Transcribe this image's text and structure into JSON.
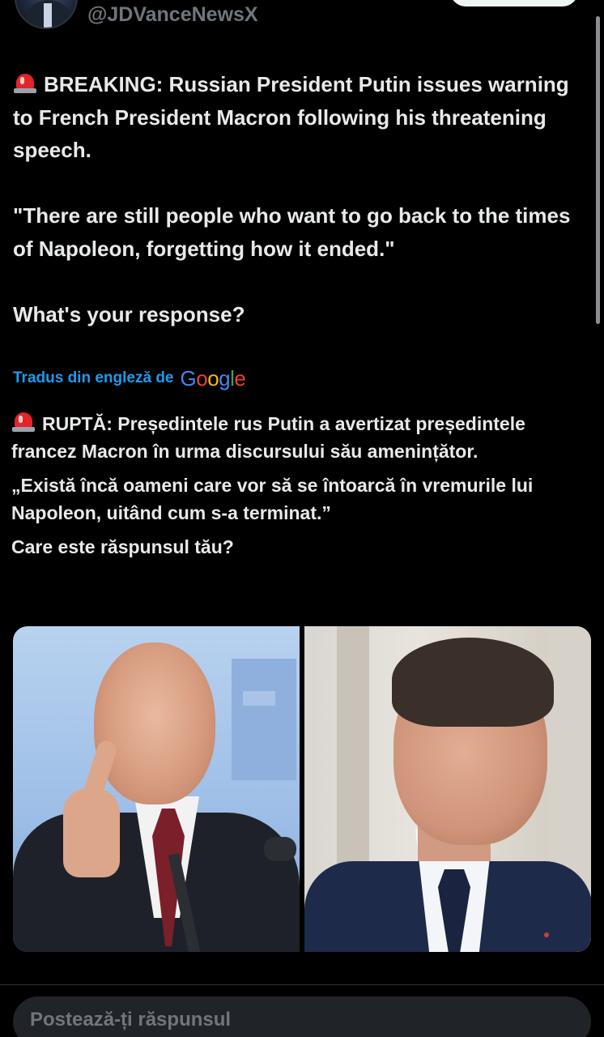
{
  "author": {
    "handle": "@JDVanceNewsX"
  },
  "tweet": {
    "breaking_line": "BREAKING: Russian President Putin issues warning to French President Macron following his threatening speech.",
    "quote": "\"There are still people who want to go back to the times of Napoleon, forgetting how it ended.\"",
    "question": "What's your response?"
  },
  "translation": {
    "label": "Tradus din engleză de",
    "provider_letters": [
      "G",
      "o",
      "o",
      "g",
      "l",
      "e"
    ],
    "breaking_line": "RUPTĂ: Președintele rus Putin a avertizat președintele francez Macron în urma discursului său amenințător.",
    "quote": "„Există încă oameni care vor să se întoarcă în vremurile lui Napoleon, uitând cum s-a terminat.”",
    "question": "Care este răspunsul tău?"
  },
  "icons": {
    "siren": "rotating-light-icon"
  },
  "reply": {
    "placeholder": "Postează-ți răspunsul"
  },
  "colors": {
    "background": "#000000",
    "text": "#e7e9ea",
    "secondary_text": "#71767b",
    "link": "#1d9bf0",
    "reply_field": "#202327"
  }
}
